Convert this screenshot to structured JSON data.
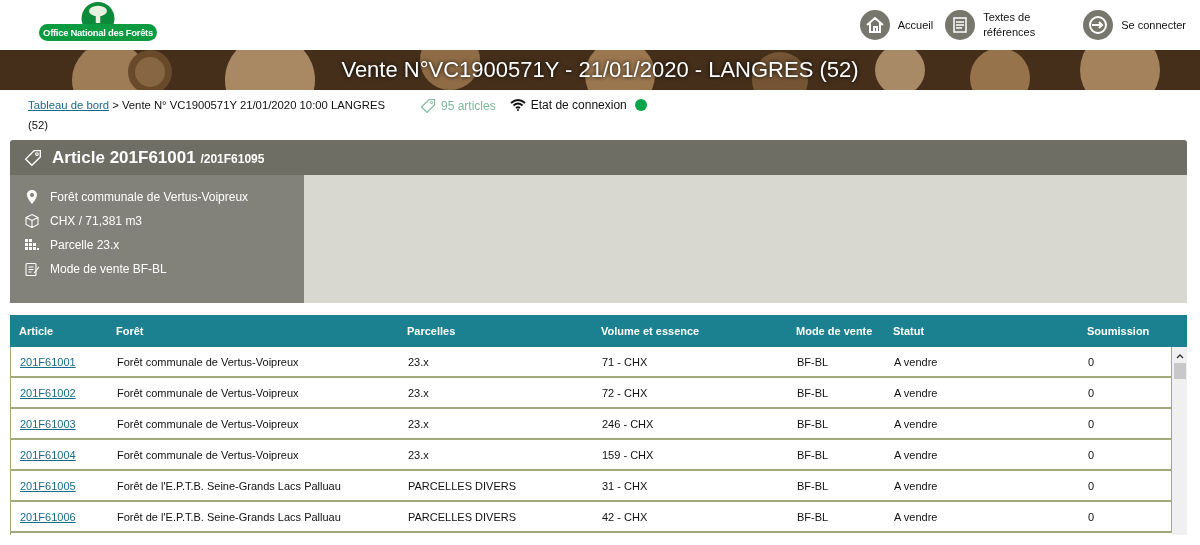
{
  "logo": {
    "text": "Office National des Forêts"
  },
  "nav": [
    {
      "kind": "home",
      "label": "Accueil"
    },
    {
      "kind": "document",
      "label": "Textes de références"
    },
    {
      "kind": "login",
      "label": "Se connecter"
    }
  ],
  "banner": {
    "title": "Vente N°VC1900571Y - 21/01/2020 - LANGRES (52)"
  },
  "breadcrumb": {
    "link": "Tableau de bord",
    "current": "> Vente N° VC1900571Y 21/01/2020 10:00 LANGRES (52)"
  },
  "articles_count": "95 articles",
  "connection": {
    "label": "Etat de connexion",
    "connected": true
  },
  "article": {
    "title": "Article 201F61001",
    "range": "/201F61095",
    "details": [
      {
        "kind": "location",
        "text": "Forêt communale de Vertus-Voipreux"
      },
      {
        "kind": "volume",
        "text": "CHX / 71,381 m3"
      },
      {
        "kind": "parcel",
        "text": "Parcelle 23.x"
      },
      {
        "kind": "mode",
        "text": "Mode de vente BF-BL"
      }
    ]
  },
  "table": {
    "columns": [
      "Article",
      "Forêt",
      "Parcelles",
      "Volume et essence",
      "Mode de vente",
      "Statut",
      "Soumission"
    ],
    "rows": [
      [
        "201F61001",
        "Forêt communale de Vertus-Voipreux",
        "23.x",
        "71 - CHX",
        "BF-BL",
        "A vendre",
        "0"
      ],
      [
        "201F61002",
        "Forêt communale de Vertus-Voipreux",
        "23.x",
        "72 - CHX",
        "BF-BL",
        "A vendre",
        "0"
      ],
      [
        "201F61003",
        "Forêt communale de Vertus-Voipreux",
        "23.x",
        "246 - CHX",
        "BF-BL",
        "A vendre",
        "0"
      ],
      [
        "201F61004",
        "Forêt communale de Vertus-Voipreux",
        "23.x",
        "159 - CHX",
        "BF-BL",
        "A vendre",
        "0"
      ],
      [
        "201F61005",
        "Forêt de l'E.P.T.B. Seine-Grands Lacs Palluau",
        "PARCELLES DIVERS",
        "31 - CHX",
        "BF-BL",
        "A vendre",
        "0"
      ],
      [
        "201F61006",
        "Forêt de l'E.P.T.B. Seine-Grands Lacs Palluau",
        "PARCELLES DIVERS",
        "42 - CHX",
        "BF-BL",
        "A vendre",
        "0"
      ]
    ]
  }
}
